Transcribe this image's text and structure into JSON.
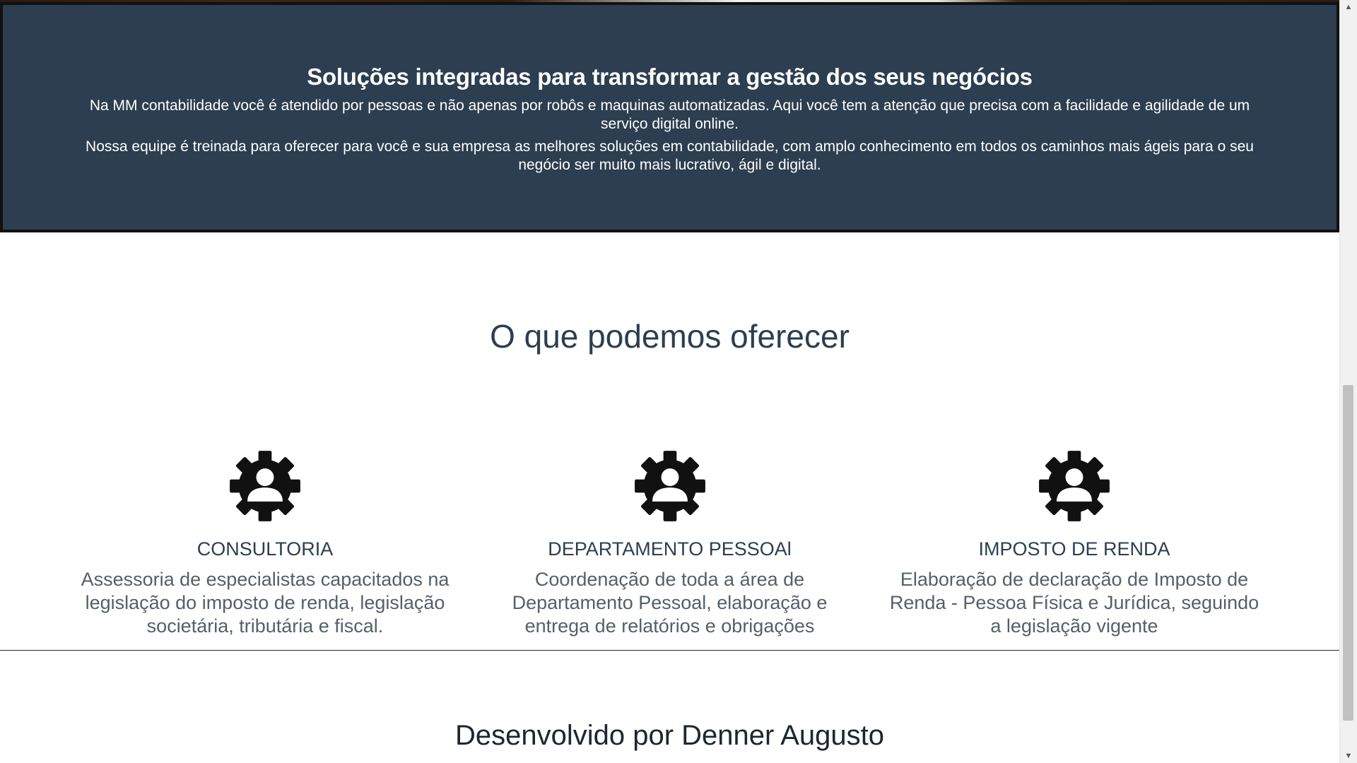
{
  "intro": {
    "title": "Soluções integradas para transformar a gestão dos seus negócios",
    "paragraph_1": "Na MM contabilidade você é atendido por pessoas e não apenas por robôs e maquinas automatizadas. Aqui você tem a atenção que precisa com a facilidade e agilidade de um serviço digital online.",
    "paragraph_2": "Nossa equipe é treinada para oferecer para você e sua empresa as melhores soluções em contabilidade, com amplo conhecimento em todos os caminhos mais ágeis para o seu negócio ser muito mais lucrativo, ágil e digital."
  },
  "offer": {
    "title": "O que podemos oferecer",
    "services": [
      {
        "icon": "user-gear-icon",
        "title": "CONSULTORIA",
        "description": "Assessoria de especialistas capacitados na legislação do imposto de renda, legislação societária, tributária e fiscal."
      },
      {
        "icon": "user-gear-icon",
        "title": "DEPARTAMENTO PESSOAl",
        "description": "Coordenação de toda a área de Departamento Pessoal, elaboração e entrega de relatórios e obrigações"
      },
      {
        "icon": "user-gear-icon",
        "title": "IMPOSTO DE RENDA",
        "description": "Elaboração de declaração de Imposto de Renda - Pessoa Física e Jurídica, seguindo a legislação vigente"
      }
    ]
  },
  "footer": {
    "credit": "Desenvolvido por Denner Augusto"
  },
  "colors": {
    "banner_background": "#2c3e50",
    "heading": "#2c3e50",
    "body_text": "#555f68",
    "icon": "#111111"
  }
}
